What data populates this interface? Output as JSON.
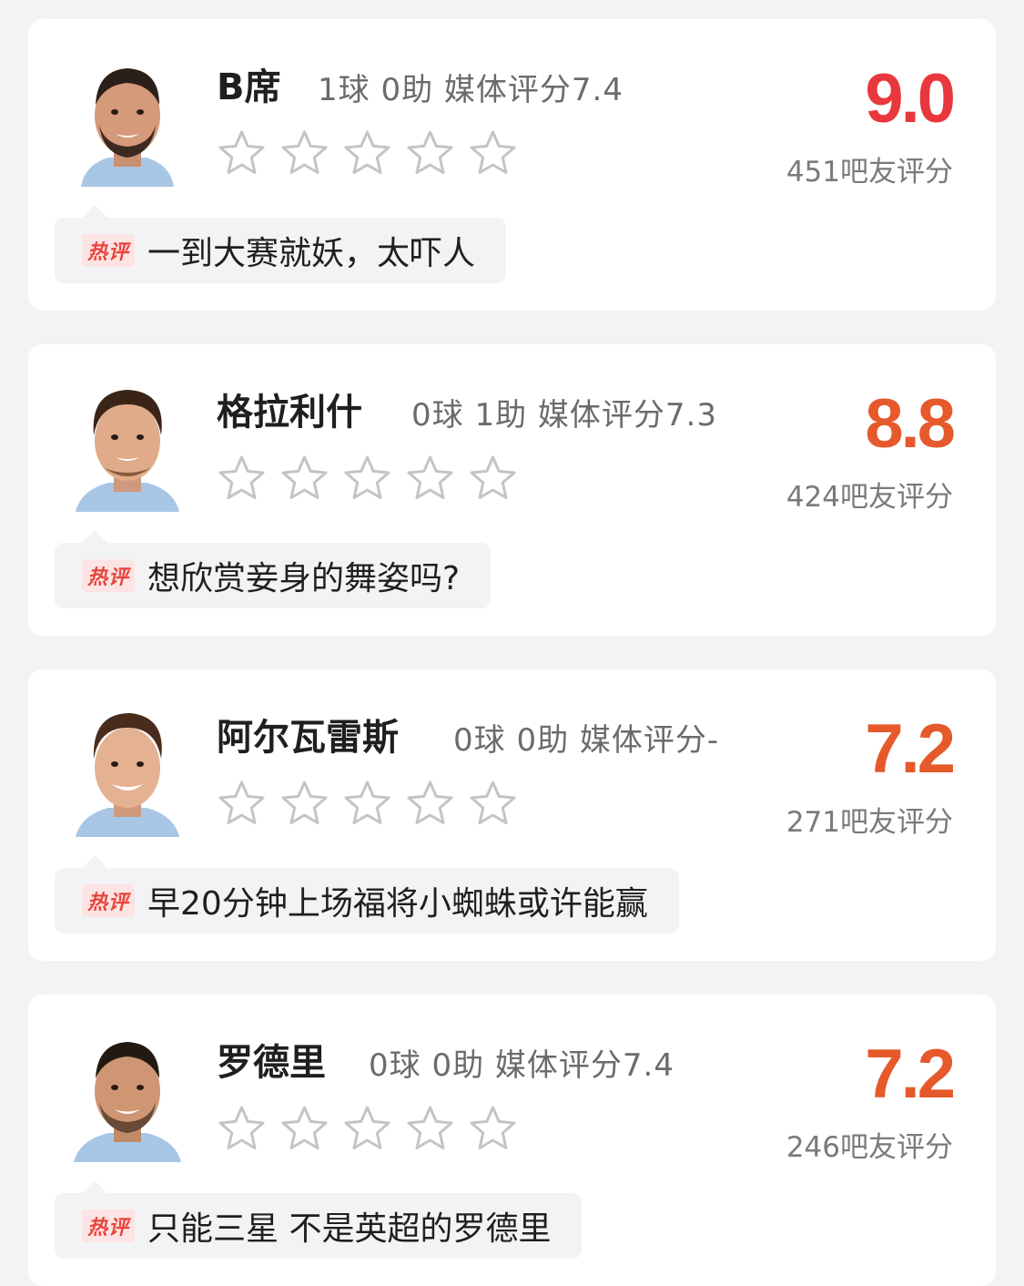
{
  "players": [
    {
      "name": "B席",
      "stats": "1球 0助  媒体评分7.4",
      "score": "9.0",
      "score_color": "#e8383d",
      "count": "451吧友评分",
      "tag": "热评",
      "comment": "一到大赛就妖，太吓人",
      "avatar_icon": "player-portrait"
    },
    {
      "name": "格拉利什",
      "stats": "0球 1助  媒体评分7.3",
      "score": "8.8",
      "score_color": "#e5592b",
      "count": "424吧友评分",
      "tag": "热评",
      "comment": "想欣赏妾身的舞姿吗?",
      "avatar_icon": "player-portrait"
    },
    {
      "name": "阿尔瓦雷斯",
      "stats": "0球 0助  媒体评分-",
      "score": "7.2",
      "score_color": "#e5592b",
      "count": "271吧友评分",
      "tag": "热评",
      "comment": "早20分钟上场福将小蜘蛛或许能赢",
      "avatar_icon": "player-portrait"
    },
    {
      "name": "罗德里",
      "stats": "0球 0助  媒体评分7.4",
      "score": "7.2",
      "score_color": "#e5592b",
      "count": "246吧友评分",
      "tag": "热评",
      "comment": "只能三星 不是英超的罗德里",
      "avatar_icon": "player-portrait"
    }
  ],
  "star_icon": "star-outline-icon",
  "stars_per_card": 5
}
